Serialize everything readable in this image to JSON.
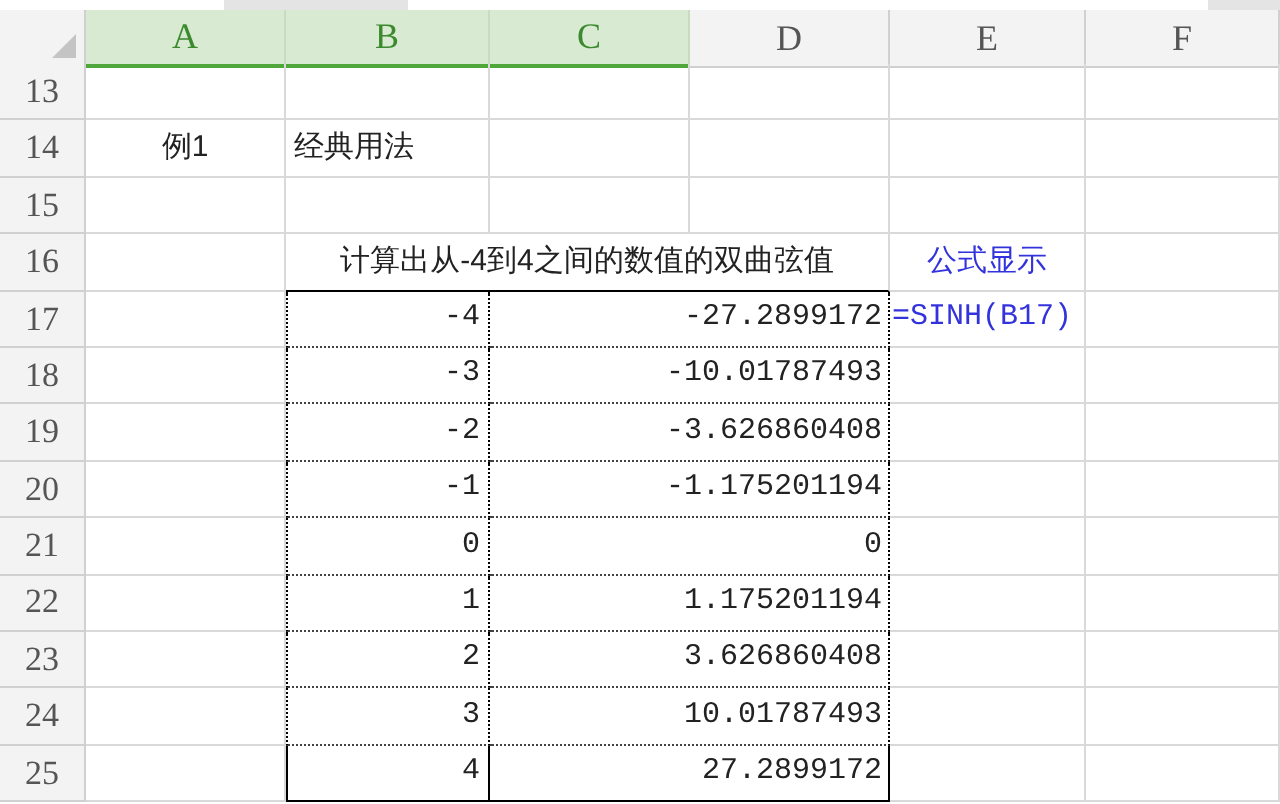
{
  "columns": [
    {
      "label": "A",
      "selected": true
    },
    {
      "label": "B",
      "selected": true
    },
    {
      "label": "C",
      "selected": true
    },
    {
      "label": "D",
      "selected": false
    },
    {
      "label": "E",
      "selected": false
    },
    {
      "label": "F",
      "selected": false
    }
  ],
  "rows": [
    {
      "number": "13",
      "kind": "blank"
    },
    {
      "number": "14",
      "kind": "label",
      "a": "例1",
      "b": "经典用法"
    },
    {
      "number": "15",
      "kind": "blank"
    },
    {
      "number": "16",
      "kind": "caption",
      "caption": "计算出从-4到4之间的数值的双曲弦值",
      "note": "公式显示"
    },
    {
      "number": "17",
      "kind": "data",
      "input": "-4",
      "result": "-27.2899172",
      "formula": "=SINH(B17)"
    },
    {
      "number": "18",
      "kind": "data",
      "input": "-3",
      "result": "-10.01787493"
    },
    {
      "number": "19",
      "kind": "data",
      "input": "-2",
      "result": "-3.626860408"
    },
    {
      "number": "20",
      "kind": "data",
      "input": "-1",
      "result": "-1.175201194"
    },
    {
      "number": "21",
      "kind": "data",
      "input": "0",
      "result": "0"
    },
    {
      "number": "22",
      "kind": "data",
      "input": "1",
      "result": "1.175201194"
    },
    {
      "number": "23",
      "kind": "data",
      "input": "2",
      "result": "3.626860408"
    },
    {
      "number": "24",
      "kind": "data",
      "input": "3",
      "result": "10.01787493"
    },
    {
      "number": "25",
      "kind": "data",
      "input": "4",
      "result": "27.2899172"
    }
  ]
}
